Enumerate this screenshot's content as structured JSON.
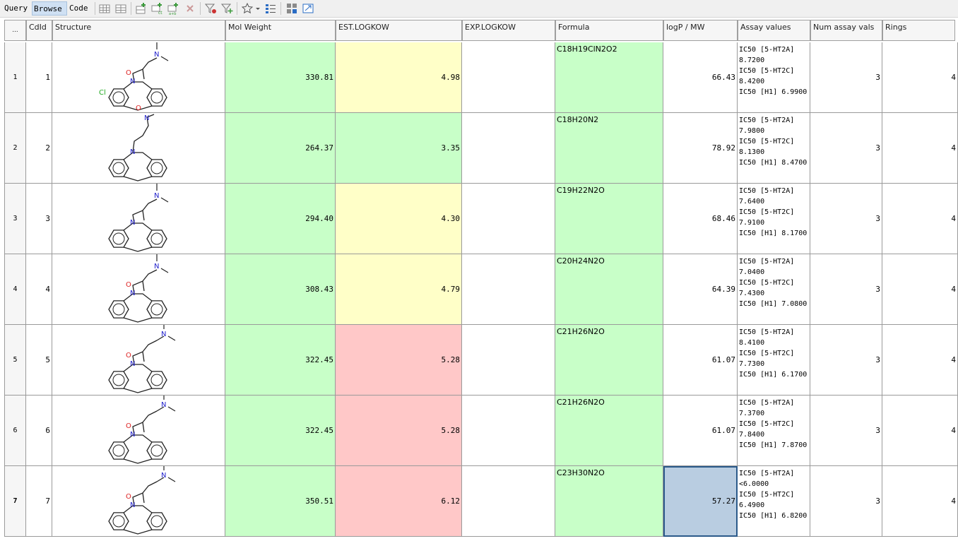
{
  "toolbar": {
    "modes": [
      "Query",
      "Browse",
      "Code"
    ],
    "active_mode": "Browse"
  },
  "colors": {
    "green": "#c8ffc8",
    "yellow": "#ffffc8",
    "red": "#ffc8c8",
    "selected": "#b9cde1"
  },
  "grid": {
    "corner_label": "...",
    "columns": [
      "CdId",
      "Structure",
      "Mol Weight",
      "EST.LOGKOW",
      "EXP.LOGKOW",
      "Formula",
      "logP / MW",
      "Assay values",
      "Num assay vals",
      "Rings"
    ],
    "rows": [
      {
        "row_num": "1",
        "cdid": "1",
        "mw": "330.81",
        "est": "4.98",
        "exp": "",
        "formula": "C18H19ClN2O2",
        "logp_mw": "66.43",
        "assay": [
          "IC50 [5-HT2A]",
          "8.7200",
          "IC50 [5-HT2C]",
          "8.4200",
          "IC50 [H1] 6.9900"
        ],
        "num_assay": "3",
        "rings": "4"
      },
      {
        "row_num": "2",
        "cdid": "2",
        "mw": "264.37",
        "est": "3.35",
        "exp": "",
        "formula": "C18H20N2",
        "logp_mw": "78.92",
        "assay": [
          "IC50 [5-HT2A]",
          "7.9800",
          "IC50 [5-HT2C]",
          "8.1300",
          "IC50 [H1] 8.4700"
        ],
        "num_assay": "3",
        "rings": "4"
      },
      {
        "row_num": "3",
        "cdid": "3",
        "mw": "294.40",
        "est": "4.30",
        "exp": "",
        "formula": "C19H22N2O",
        "logp_mw": "68.46",
        "assay": [
          "IC50 [5-HT2A]",
          "7.6400",
          "IC50 [5-HT2C]",
          "7.9100",
          "IC50 [H1] 8.1700"
        ],
        "num_assay": "3",
        "rings": "4"
      },
      {
        "row_num": "4",
        "cdid": "4",
        "mw": "308.43",
        "est": "4.79",
        "exp": "",
        "formula": "C20H24N2O",
        "logp_mw": "64.39",
        "assay": [
          "IC50 [5-HT2A]",
          "7.0400",
          "IC50 [5-HT2C]",
          "7.4300",
          "IC50 [H1] 7.0800"
        ],
        "num_assay": "3",
        "rings": "4"
      },
      {
        "row_num": "5",
        "cdid": "5",
        "mw": "322.45",
        "est": "5.28",
        "exp": "",
        "formula": "C21H26N2O",
        "logp_mw": "61.07",
        "assay": [
          "IC50 [5-HT2A]",
          "8.4100",
          "IC50 [5-HT2C]",
          "7.7300",
          "IC50 [H1] 6.1700"
        ],
        "num_assay": "3",
        "rings": "4"
      },
      {
        "row_num": "6",
        "cdid": "6",
        "mw": "322.45",
        "est": "5.28",
        "exp": "",
        "formula": "C21H26N2O",
        "logp_mw": "61.07",
        "assay": [
          "IC50 [5-HT2A]",
          "7.3700",
          "IC50 [5-HT2C]",
          "7.8400",
          "IC50 [H1] 7.8700"
        ],
        "num_assay": "3",
        "rings": "4"
      },
      {
        "row_num": "7",
        "cdid": "7",
        "mw": "350.51",
        "est": "6.12",
        "exp": "",
        "formula": "C23H30N2O",
        "logp_mw": "57.27",
        "assay": [
          "IC50 [5-HT2A]",
          "<6.0000",
          "IC50 [5-HT2C]",
          "6.4900",
          "IC50 [H1] 6.8200"
        ],
        "num_assay": "3",
        "rings": "4"
      }
    ]
  }
}
